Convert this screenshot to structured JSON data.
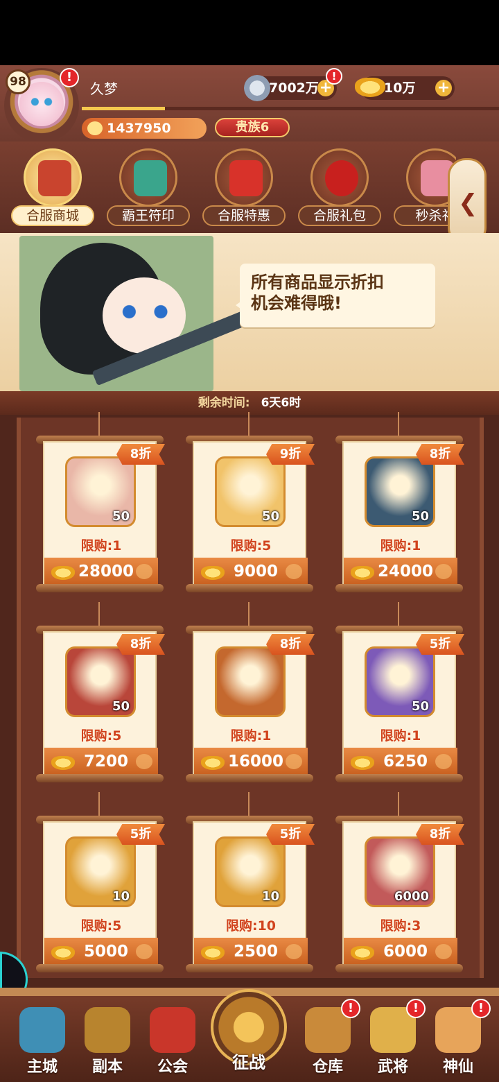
{
  "player": {
    "level": "98",
    "name": "久梦",
    "power": "1437950",
    "noble": "贵族6",
    "exp_fraction": 0.2
  },
  "currency": {
    "silver": "7002万",
    "gold": "10万"
  },
  "tabs": [
    {
      "label": "合服商城",
      "active": true
    },
    {
      "label": "霸王符印",
      "active": false
    },
    {
      "label": "合服特惠",
      "active": false
    },
    {
      "label": "合服礼包",
      "active": false
    },
    {
      "label": "秒杀礼",
      "active": false
    }
  ],
  "banner": {
    "message_line1": "所有商品显示折扣",
    "message_line2": "机会难得哦!"
  },
  "timer": {
    "label": "剩余时间:",
    "value": "6天6时"
  },
  "shop": {
    "items": [
      {
        "discount": "8折",
        "level": "50",
        "limit": "限购:1",
        "price": "28000",
        "color": "#e9b7a8"
      },
      {
        "discount": "9折",
        "level": "50",
        "limit": "限购:5",
        "price": "9000",
        "color": "#f1c36a"
      },
      {
        "discount": "8折",
        "level": "50",
        "limit": "限购:1",
        "price": "24000",
        "color": "#3c5a72"
      },
      {
        "discount": "8折",
        "level": "50",
        "limit": "限购:5",
        "price": "7200",
        "color": "#b9463a"
      },
      {
        "discount": "8折",
        "level": "",
        "limit": "限购:1",
        "price": "16000",
        "color": "#c4682e"
      },
      {
        "discount": "5折",
        "level": "50",
        "limit": "限购:1",
        "price": "6250",
        "color": "#7d5ab8"
      },
      {
        "discount": "5折",
        "level": "10",
        "limit": "限购:5",
        "price": "5000",
        "color": "#e0a23a"
      },
      {
        "discount": "5折",
        "level": "10",
        "limit": "限购:10",
        "price": "2500",
        "color": "#e0a23a"
      },
      {
        "discount": "8折",
        "level": "6000",
        "limit": "限购:3",
        "price": "6000",
        "color": "#c25a5a"
      }
    ]
  },
  "nav": {
    "items": [
      "主城",
      "副本",
      "公会",
      "征战",
      "仓库",
      "武将",
      "神仙"
    ]
  },
  "colors": {
    "discount_tag": "#e0662a",
    "limit_text": "#d1431e",
    "price_bar": "#d9702e",
    "header_bg": "#7a3f30"
  }
}
